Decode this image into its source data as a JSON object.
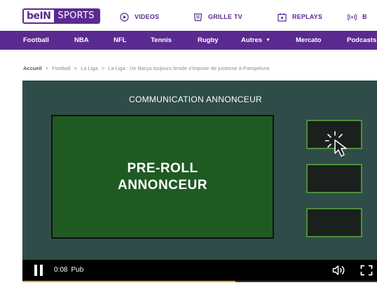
{
  "header": {
    "logo": {
      "part1": "beIN",
      "part2": "SPORTS"
    },
    "nav": [
      {
        "label": "VIDEOS",
        "icon": "play-circle-icon"
      },
      {
        "label": "GRILLE TV",
        "icon": "tv-guide-icon"
      },
      {
        "label": "REPLAYS",
        "icon": "replay-icon"
      },
      {
        "label": "B",
        "icon": "live-signal-icon"
      }
    ]
  },
  "sports_nav": [
    {
      "label": "Football"
    },
    {
      "label": "NBA"
    },
    {
      "label": "NFL"
    },
    {
      "label": "Tennis"
    },
    {
      "label": "Rugby"
    },
    {
      "label": "Autres",
      "has_dropdown": true
    },
    {
      "label": "Mercato"
    },
    {
      "label": "Podcasts"
    }
  ],
  "breadcrumb": [
    "Accueil",
    "Football",
    "La Liga",
    "La Liga : Un Barça toujours timide s'impose de justesse à Pampelune"
  ],
  "player": {
    "ad_banner_title": "COMMUNICATION ANNONCEUR",
    "preroll_line1": "PRE-ROLL",
    "preroll_line2": "ANNONCEUR",
    "time": "0:08",
    "status_label": "Pub",
    "progress": 0.6,
    "progress_color": "#f2a516"
  },
  "colors": {
    "brand_purple": "#5b2a91",
    "player_bg": "#2f4c48",
    "preroll_green": "#1f5a23",
    "thumb_border": "#4f8e3c"
  }
}
